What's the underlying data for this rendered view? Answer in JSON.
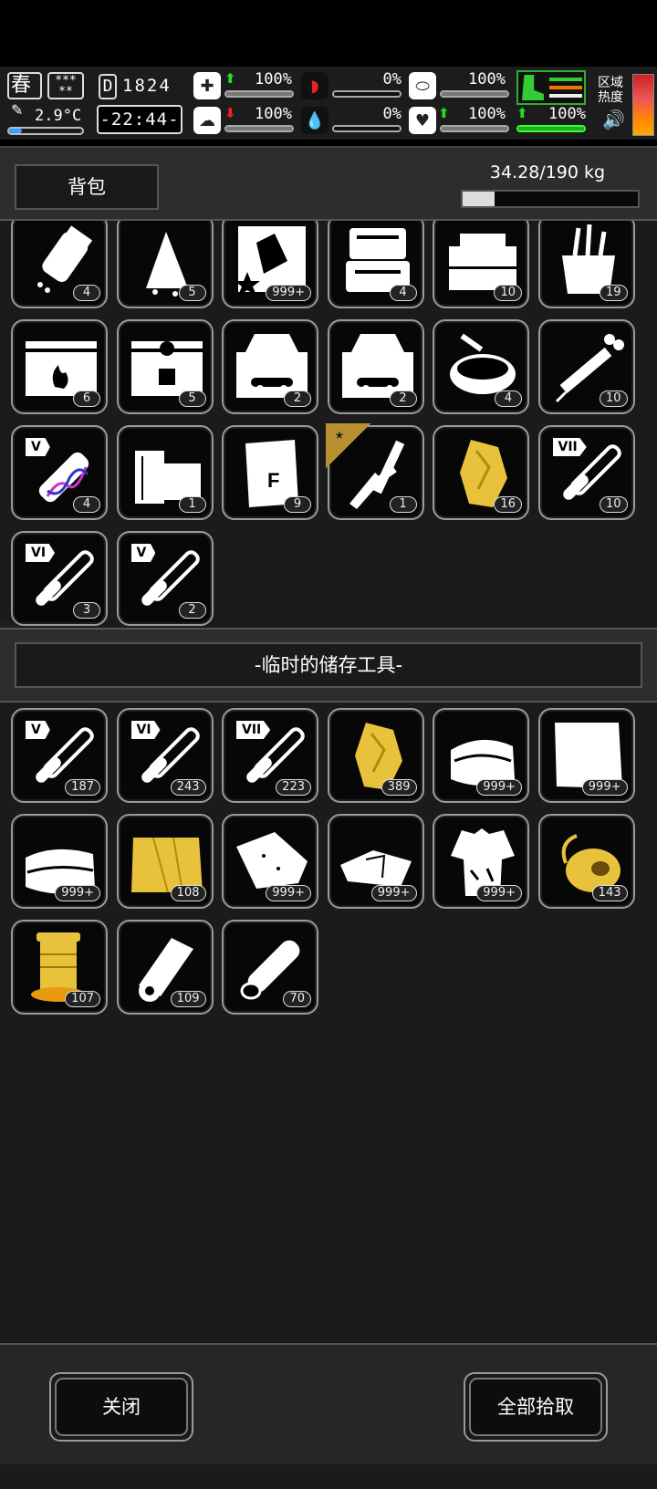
{
  "status": {
    "season": "春",
    "weather": "*** **",
    "temperature": "2.9°C",
    "day_icon": "D",
    "day": "1824",
    "time": "-22:44-",
    "stats": [
      {
        "id": "health",
        "icon": "medkit-icon",
        "arrow": "up",
        "value": "100%"
      },
      {
        "id": "hunger",
        "icon": "stomach-icon",
        "arrow": "",
        "value": "0%"
      },
      {
        "id": "stamina",
        "icon": "capsule-icon",
        "arrow": "",
        "value": "100%"
      },
      {
        "id": "brain",
        "icon": "brain-icon",
        "arrow": "down",
        "value": "100%"
      },
      {
        "id": "blood",
        "icon": "blood-drop-icon",
        "arrow": "",
        "value": "0%"
      },
      {
        "id": "heart",
        "icon": "heart-icon",
        "arrow": "up",
        "value": "100%"
      }
    ],
    "carry": {
      "arrow": "up",
      "value": "100%"
    },
    "zone_label": "区域热度"
  },
  "bag": {
    "title": "背包",
    "weight": "34.28/190 kg",
    "weight_fraction": 0.18,
    "items": [
      {
        "icon": "pill-bottle-icon",
        "count": "4"
      },
      {
        "icon": "wet-cloth-icon",
        "count": "5"
      },
      {
        "icon": "book-icon",
        "count": "999+"
      },
      {
        "icon": "toolcase-icon",
        "count": "4"
      },
      {
        "icon": "toolbox-icon",
        "count": "10"
      },
      {
        "icon": "tool-bag-icon",
        "count": "19"
      },
      {
        "icon": "crate-fire-icon",
        "count": "6"
      },
      {
        "icon": "crate-lock-icon",
        "count": "5"
      },
      {
        "icon": "car-toolbox-icon",
        "count": "2"
      },
      {
        "icon": "car-toolbox-full-icon",
        "count": "2"
      },
      {
        "icon": "soup-bowl-icon",
        "count": "4"
      },
      {
        "icon": "syringe-icon",
        "count": "10"
      },
      {
        "icon": "dna-tube-icon",
        "count": "4",
        "roman": "V"
      },
      {
        "icon": "wood-plank-icon",
        "count": "1"
      },
      {
        "icon": "flour-sack-icon",
        "count": "9"
      },
      {
        "icon": "knife-caliper-icon",
        "count": "1",
        "fav": true
      },
      {
        "icon": "gold-ore-icon",
        "count": "16"
      },
      {
        "icon": "test-tube-icon",
        "count": "10",
        "roman": "VII"
      },
      {
        "icon": "test-tube-icon",
        "count": "3",
        "roman": "VI"
      },
      {
        "icon": "test-tube-icon",
        "count": "2",
        "roman": "V"
      }
    ]
  },
  "storage": {
    "title": "-临时的储存工具-",
    "items": [
      {
        "icon": "test-tube-icon",
        "count": "187",
        "roman": "V"
      },
      {
        "icon": "test-tube-icon",
        "count": "243",
        "roman": "VI"
      },
      {
        "icon": "test-tube-icon",
        "count": "223",
        "roman": "VII"
      },
      {
        "icon": "gold-ore-icon",
        "count": "389"
      },
      {
        "icon": "folded-cloth-icon",
        "count": "999+"
      },
      {
        "icon": "paper-sheet-icon",
        "count": "999+"
      },
      {
        "icon": "fabric-icon",
        "count": "999+"
      },
      {
        "icon": "gold-fabric-icon",
        "count": "108"
      },
      {
        "icon": "leather-icon",
        "count": "999+"
      },
      {
        "icon": "cloth-pieces-icon",
        "count": "999+"
      },
      {
        "icon": "torn-shirt-icon",
        "count": "999+"
      },
      {
        "icon": "gold-thread-icon",
        "count": "143"
      },
      {
        "icon": "gold-spool-icon",
        "count": "107"
      },
      {
        "icon": "paper-roll-icon",
        "count": "109"
      },
      {
        "icon": "log-icon",
        "count": "70"
      }
    ]
  },
  "buttons": {
    "close": "关闭",
    "pickup_all": "全部拾取"
  },
  "colors": {
    "gold": "#e8c23a",
    "green": "#33cc33",
    "red": "#dd2222",
    "panel": "#262626"
  }
}
